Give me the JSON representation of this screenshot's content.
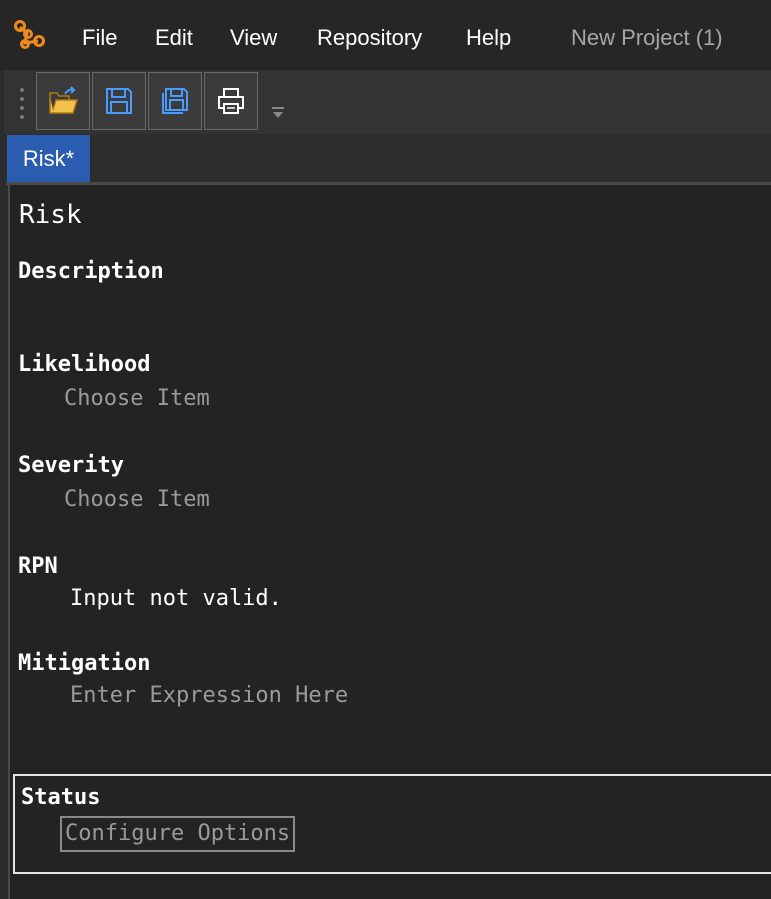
{
  "menu": {
    "file": "File",
    "edit": "Edit",
    "view": "View",
    "repository": "Repository",
    "help": "Help"
  },
  "window_title": "New Project (1)",
  "toolbar": {
    "buttons": [
      "folder-open-icon",
      "save-icon",
      "save-all-icon",
      "print-icon"
    ]
  },
  "tabs": [
    {
      "label": "Risk*",
      "active": true
    }
  ],
  "editor": {
    "title": "Risk",
    "fields": {
      "description": {
        "label": "Description"
      },
      "likelihood": {
        "label": "Likelihood",
        "placeholder": "Choose Item"
      },
      "severity": {
        "label": "Severity",
        "placeholder": "Choose Item"
      },
      "rpn": {
        "label": "RPN",
        "value": "Input not valid."
      },
      "mitigation": {
        "label": "Mitigation",
        "placeholder": "Enter Expression Here"
      },
      "status": {
        "label": "Status",
        "button": "Configure Options"
      }
    }
  },
  "colors": {
    "accent_tab": "#2a5db0",
    "logo": "#f08a1c",
    "icon_blue": "#4a9bff",
    "icon_folder": "#f2c14e"
  }
}
